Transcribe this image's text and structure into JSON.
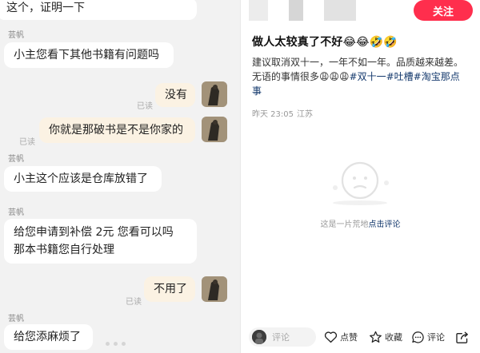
{
  "chat": {
    "messages": [
      {
        "sender": "other",
        "text": "这个，证明一下"
      },
      {
        "sender": "other",
        "name": "芸帆",
        "text": "小主您看下其他书籍有问题吗"
      },
      {
        "sender": "me",
        "status": "已读",
        "text": "没有"
      },
      {
        "sender": "me",
        "status": "已读",
        "text": "你就是那破书是不是你家的"
      },
      {
        "sender": "other",
        "name": "芸帆",
        "text": "小主这个应该是仓库放错了"
      },
      {
        "sender": "other",
        "name": "芸帆",
        "lines": [
          "给您申请到补偿 2元 您看可以吗",
          "那本书籍您自行处理"
        ]
      },
      {
        "sender": "me",
        "status": "已读",
        "text": "不用了"
      },
      {
        "sender": "other",
        "name": "芸帆",
        "text": "给您添麻烦了"
      }
    ]
  },
  "post": {
    "follow_label": "关注",
    "title": "做人太较真了不好",
    "title_emoji": "😂😂🤣🤣",
    "body_line1": "建议取消双十一，一年不如一年。品质越来越差。",
    "body_line2_text": "无语的事情很多",
    "body_line2_emoji": "😩😩😩",
    "tags": [
      "#双十一",
      "#吐槽",
      "#淘宝那点",
      "事"
    ],
    "time": "昨天 23:05",
    "location": "江苏",
    "empty_text": "这是一片荒地",
    "empty_link": "点击评论"
  },
  "bottom_bar": {
    "comment_placeholder": "评论",
    "like_label": "点赞",
    "collect_label": "收藏",
    "comment_label": "评论"
  },
  "colors": {
    "accent": "#ff2e4d",
    "tag": "#13386c",
    "my_bubble": "#fbf2e3"
  }
}
